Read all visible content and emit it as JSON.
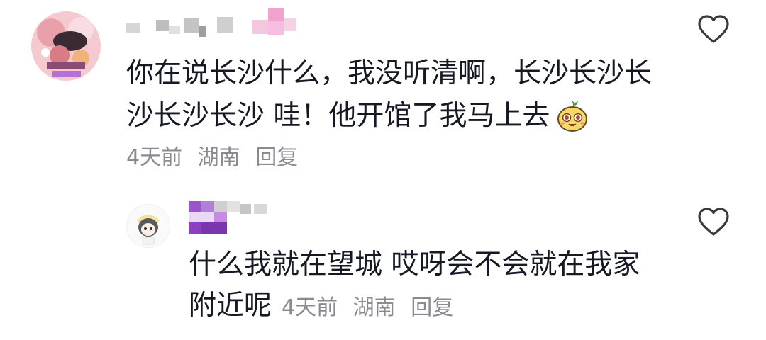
{
  "comments": [
    {
      "text_line1": "你在说长沙什么，我没听清啊，长沙长沙长",
      "text_line2": "沙长沙长沙 哇！他开馆了我马上去",
      "emoji": "smiling-pear-emoji",
      "time": "4天前",
      "location": "湖南",
      "reply_label": "回复",
      "like_icon": "heart-outline-icon"
    },
    {
      "text_line1": "什么我就在望城 哎呀会不会就在我家",
      "text_line2": "附近呢",
      "time": "4天前",
      "location": "湖南",
      "reply_label": "回复",
      "like_icon": "heart-outline-icon"
    }
  ],
  "colors": {
    "text": "#161823",
    "meta": "#8a8b91",
    "blur_gray": "#c9c9c9",
    "blur_pink": "#f2a2cf",
    "blur_purple": "#9a56c9"
  }
}
